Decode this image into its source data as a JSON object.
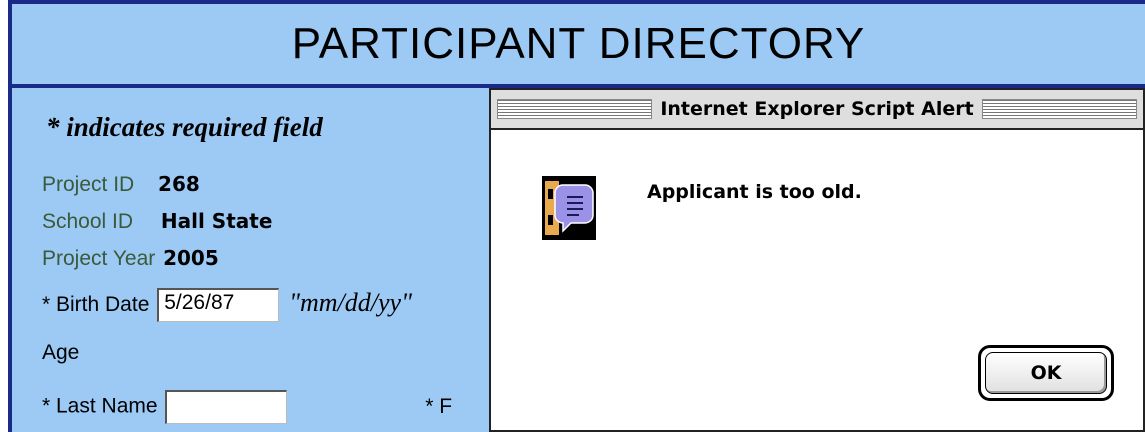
{
  "page": {
    "title": "PARTICIPANT DIRECTORY",
    "required_note": "* indicates required field"
  },
  "form": {
    "project_id": {
      "label": "Project ID",
      "value": "268"
    },
    "school_id": {
      "label": "School ID",
      "value": "Hall State"
    },
    "project_year": {
      "label": "Project Year",
      "value": "2005"
    },
    "birth_date": {
      "label": "* Birth Date",
      "value": "5/26/87",
      "format_hint": "\"mm/dd/yy\""
    },
    "age": {
      "label": "Age"
    },
    "last_name": {
      "label": "* Last Name",
      "value": ""
    },
    "first_name": {
      "label_partial": "* F"
    }
  },
  "dialog": {
    "title": "Internet Explorer Script Alert",
    "message": "Applicant is too old.",
    "ok_label": "OK",
    "icon": "alert-speech-icon"
  },
  "colors": {
    "page_background": "#9ccaf5",
    "frame_border": "#1a2a8a",
    "label_green": "#3a5a3a",
    "dialog_background": "#ffffff"
  }
}
